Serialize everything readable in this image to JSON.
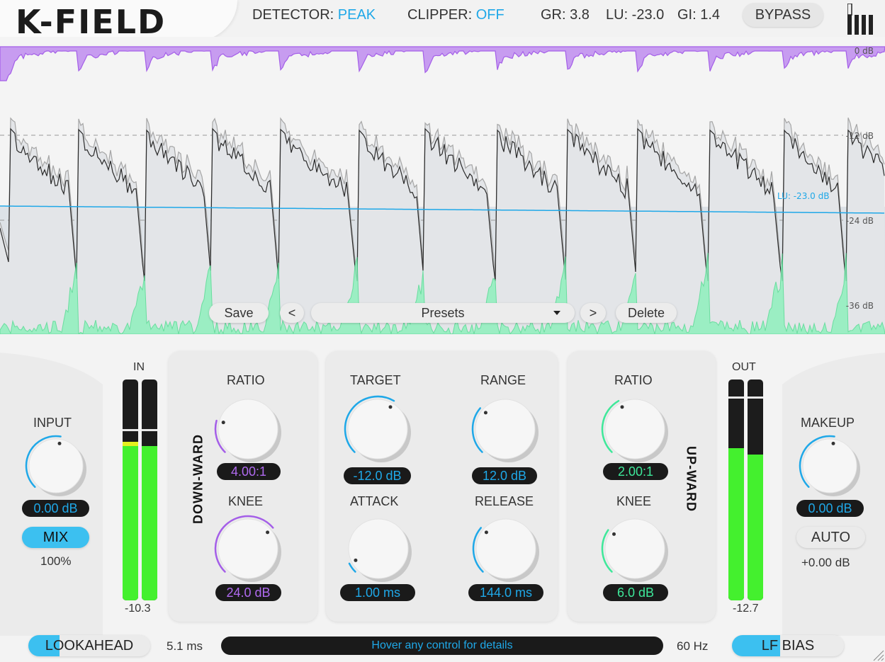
{
  "header": {
    "logo": "K-FIELD",
    "detector_label": "DETECTOR:",
    "detector_value": "PEAK",
    "clipper_label": "CLIPPER:",
    "clipper_value": "OFF",
    "gr": "GR: 3.8",
    "lu": "LU: -23.0",
    "gi": "GI: 1.4",
    "bypass_label": "BYPASS",
    "brand_icon": "bar-logo-icon"
  },
  "graph": {
    "db_labels": [
      "0 dB",
      "-12 dB",
      "-24 dB",
      "-36 dB"
    ],
    "lu_label": "LU: -23.0 dB"
  },
  "presets": {
    "save": "Save",
    "prev": "<",
    "name": "Presets",
    "next": ">",
    "delete": "Delete"
  },
  "input": {
    "title": "INPUT",
    "value": "0.00 dB",
    "mix_label": "MIX",
    "mix_value": "100%"
  },
  "in_meter": {
    "label": "IN",
    "value": "-10.3"
  },
  "downward": {
    "side_label": "DOWN-WARD",
    "ratio_title": "RATIO",
    "ratio_value": "4.00:1",
    "knee_title": "KNEE",
    "knee_value": "24.0 dB"
  },
  "center": {
    "target_title": "TARGET",
    "target_value": "-12.0 dB",
    "range_title": "RANGE",
    "range_value": "12.0 dB",
    "attack_title": "ATTACK",
    "attack_value": "1.00 ms",
    "release_title": "RELEASE",
    "release_value": "144.0 ms"
  },
  "upward": {
    "side_label": "UP-WARD",
    "ratio_title": "RATIO",
    "ratio_value": "2.00:1",
    "knee_title": "KNEE",
    "knee_value": "6.0 dB"
  },
  "out_meter": {
    "label": "OUT",
    "value": "-12.7"
  },
  "makeup": {
    "title": "MAKEUP",
    "value": "0.00 dB",
    "auto_label": "AUTO",
    "auto_value": "+0.00 dB"
  },
  "footer": {
    "lookahead_label": "LOOKAHEAD",
    "lookahead_value": "5.1 ms",
    "status_text": "Hover any control for details",
    "lf_value": "60 Hz",
    "lf_bias_label": "LF BIAS"
  },
  "colors": {
    "accent_blue": "#1fa8e8",
    "purple": "#a45ee8",
    "green": "#3ee89a",
    "meter_green": "#44f02e"
  }
}
